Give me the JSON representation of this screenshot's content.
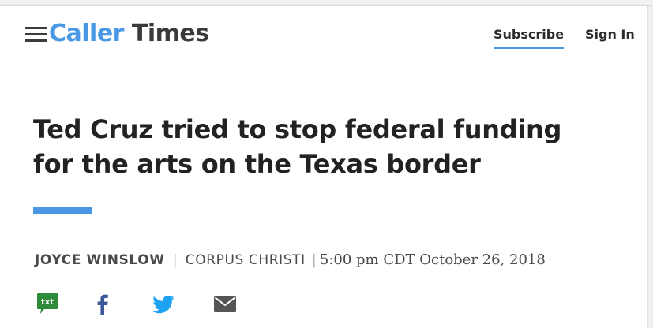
{
  "site": {
    "logo_part1": "Caller",
    "logo_part2": "Times",
    "brand_color": "#4a97e6"
  },
  "nav": {
    "subscribe_label": "Subscribe",
    "signin_label": "Sign In",
    "menu_icon": "hamburger-menu-icon"
  },
  "article": {
    "headline": "Ted Cruz tried to stop federal funding for the arts on the Texas border",
    "author": "Joyce Winslow",
    "location": "Corpus Christi",
    "timestamp": "5:00 pm CDT October 26, 2018",
    "separator": "|"
  },
  "share": {
    "sms_label": "txt",
    "icons": [
      "sms-icon",
      "facebook-icon",
      "twitter-icon",
      "email-icon"
    ],
    "facebook_color": "#3b5998",
    "twitter_color": "#1da1f2",
    "sms_color": "#2e8b3a",
    "email_color": "#555555"
  }
}
